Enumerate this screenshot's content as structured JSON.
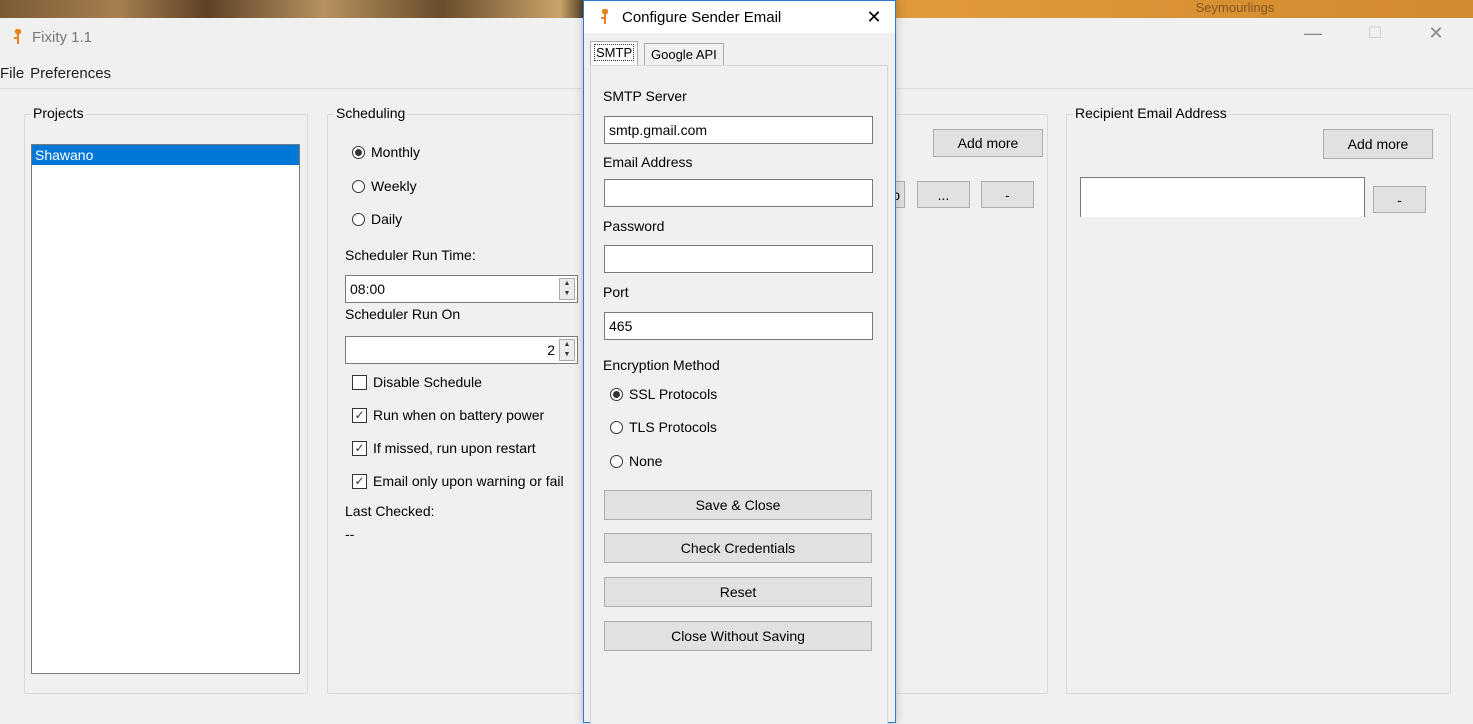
{
  "background": {
    "text": "Seymourlings"
  },
  "window": {
    "title": "Fixity 1.1",
    "controls": {
      "minimize": "—",
      "maximize": "☐",
      "close": "✕"
    }
  },
  "menu": {
    "file": "File",
    "preferences": "Preferences"
  },
  "projects": {
    "label": "Projects",
    "items": [
      "Shawano"
    ]
  },
  "scheduling": {
    "label": "Scheduling",
    "options": [
      "Monthly",
      "Weekly",
      "Daily"
    ],
    "selected": "Monthly",
    "run_time_label": "Scheduler Run Time:",
    "run_time_value": "08:00",
    "run_on_label": "Scheduler Run On",
    "run_on_value": "2",
    "checks": [
      {
        "label": "Disable Schedule",
        "checked": false
      },
      {
        "label": "Run when on battery power",
        "checked": true
      },
      {
        "label": "If missed, run upon restart",
        "checked": true
      },
      {
        "label": "Email only upon warning or fail",
        "checked": true
      }
    ],
    "last_checked_label": "Last Checked:",
    "last_checked_value": "--"
  },
  "directories": {
    "add_more": "Add more",
    "partial_label": "p",
    "browse": "...",
    "remove": "-"
  },
  "recipient": {
    "label": "Recipient Email Address",
    "add_more": "Add more",
    "remove": "-",
    "value": ""
  },
  "dialog": {
    "title": "Configure Sender Email",
    "close": "✕",
    "tabs": [
      "SMTP",
      "Google API"
    ],
    "active_tab": "SMTP",
    "smtp_server_label": "SMTP Server",
    "smtp_server_value": "smtp.gmail.com",
    "email_label": "Email Address",
    "email_value": "",
    "password_label": "Password",
    "password_value": "",
    "port_label": "Port",
    "port_value": "465",
    "encryption_label": "Encryption Method",
    "encryption_options": [
      "SSL Protocols",
      "TLS Protocols",
      "None"
    ],
    "encryption_selected": "SSL Protocols",
    "buttons": {
      "save": "Save & Close",
      "check": "Check Credentials",
      "reset": "Reset",
      "close": "Close Without Saving"
    }
  },
  "colors": {
    "selection": "#0078d7",
    "accent_icon": "#e8821e",
    "dialog_border": "#2b7bd0"
  }
}
